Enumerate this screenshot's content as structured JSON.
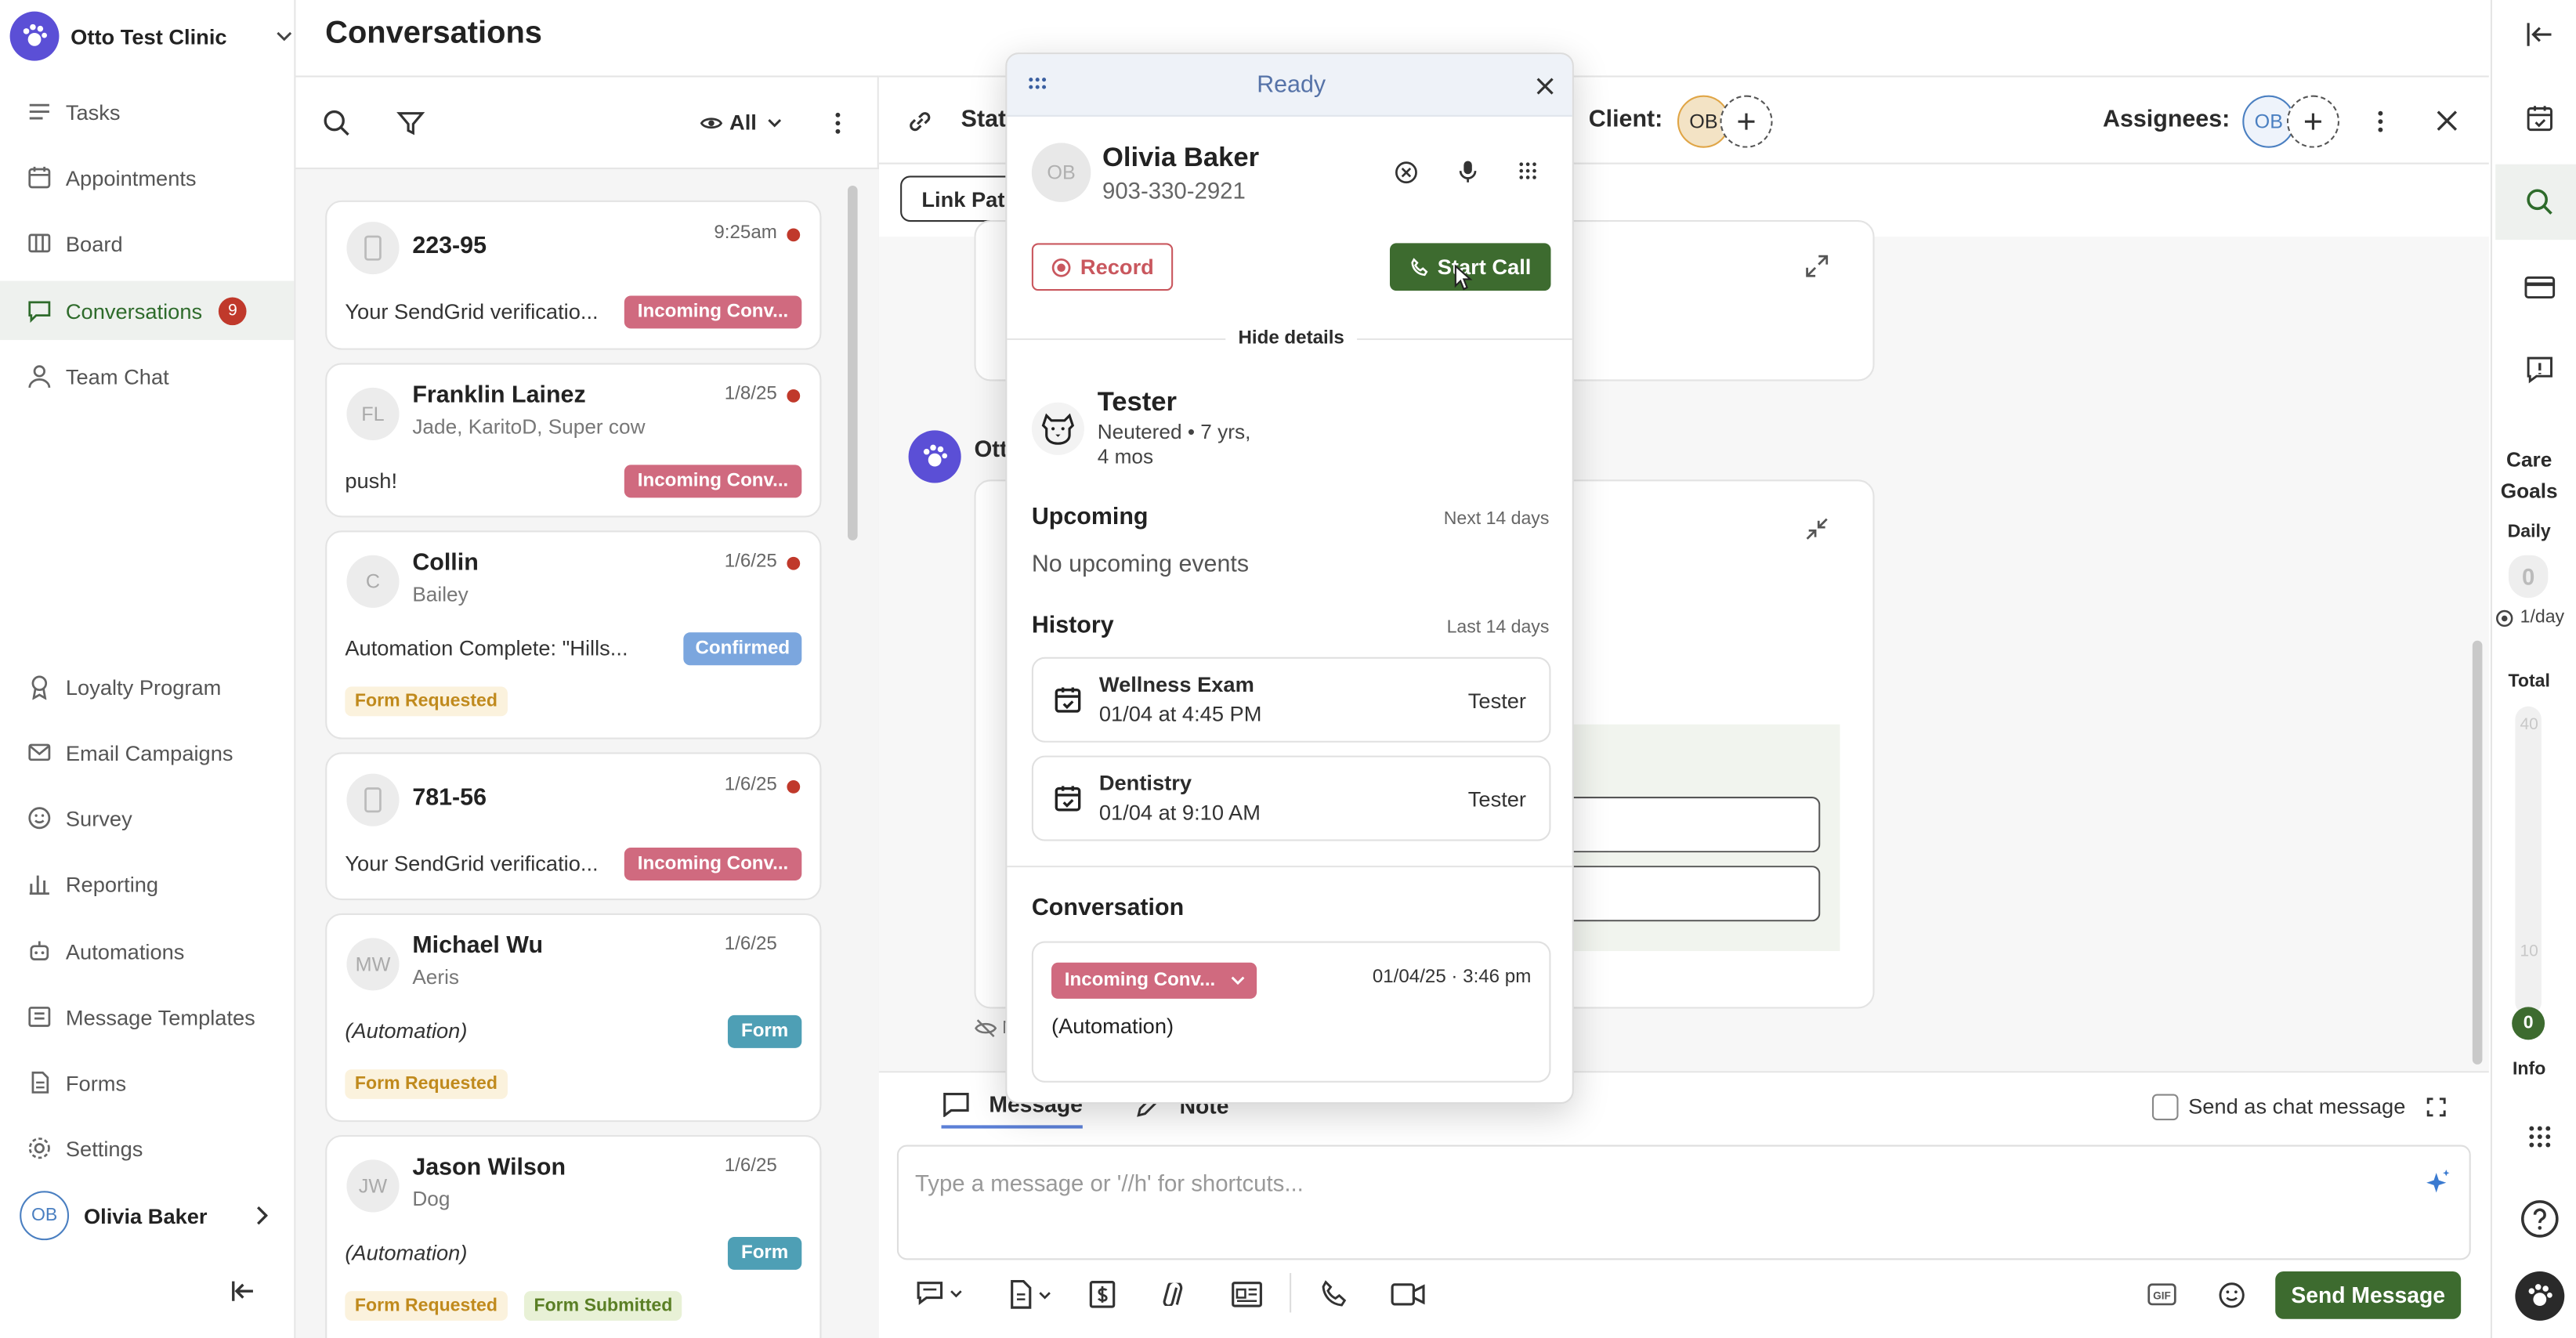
{
  "app": {
    "clinic_name": "Otto Test Clinic",
    "page_title": "Conversations"
  },
  "sidebar": {
    "items": [
      {
        "label": "Tasks",
        "icon": "tasks-icon"
      },
      {
        "label": "Appointments",
        "icon": "calendar-icon"
      },
      {
        "label": "Board",
        "icon": "board-icon"
      },
      {
        "label": "Conversations",
        "icon": "chat-icon",
        "badge": "9",
        "active": true
      },
      {
        "label": "Team Chat",
        "icon": "team-icon"
      },
      {
        "label": "Loyalty Program",
        "icon": "loyalty-icon"
      },
      {
        "label": "Email Campaigns",
        "icon": "mail-icon"
      },
      {
        "label": "Survey",
        "icon": "smile-icon"
      },
      {
        "label": "Reporting",
        "icon": "chart-icon"
      },
      {
        "label": "Automations",
        "icon": "robot-icon"
      },
      {
        "label": "Message Templates",
        "icon": "template-icon"
      },
      {
        "label": "Forms",
        "icon": "form-icon"
      },
      {
        "label": "Settings",
        "icon": "gear-icon"
      }
    ],
    "user": {
      "initials": "OB",
      "name": "Olivia Baker"
    }
  },
  "list": {
    "filter_label": "All",
    "conversations": [
      {
        "avatar": "",
        "name": "223-95",
        "sub": "",
        "date": "9:25am",
        "message": "Your SendGrid verificatio...",
        "status": "Incoming Conv...",
        "status_color": "pink",
        "unread": true
      },
      {
        "avatar": "FL",
        "name": "Franklin Lainez",
        "sub": "Jade, KaritoD, Super cow",
        "date": "1/8/25",
        "message": "push!",
        "status": "Incoming Conv...",
        "status_color": "pink",
        "unread": true
      },
      {
        "avatar": "C",
        "name": "Collin",
        "sub": "Bailey",
        "date": "1/6/25",
        "message": "Automation Complete: \"Hills...",
        "status": "Confirmed",
        "status_color": "blue",
        "unread": true,
        "tags": [
          "Form Requested"
        ]
      },
      {
        "avatar": "",
        "name": "781-56",
        "sub": "",
        "date": "1/6/25",
        "message": "Your SendGrid verificatio...",
        "status": "Incoming Conv...",
        "status_color": "pink",
        "unread": true
      },
      {
        "avatar": "MW",
        "name": "Michael Wu",
        "sub": "Aeris",
        "date": "1/6/25",
        "message": "(Automation)",
        "status": "Form",
        "status_color": "teal",
        "unread": false,
        "tags": [
          "Form Requested"
        ]
      },
      {
        "avatar": "JW",
        "name": "Jason Wilson",
        "sub": "Dog",
        "date": "1/6/25",
        "message": "(Automation)",
        "status": "Form",
        "status_color": "teal",
        "unread": false,
        "tags": [
          "Form Requested",
          "Form Submitted"
        ]
      }
    ]
  },
  "chat": {
    "status_label": "Stat",
    "client_label": "Client:",
    "client_initials": "OB",
    "assignees_label": "Assignees:",
    "assignee_initials": "OB",
    "link_patient_label": "Link Pati",
    "sender_partial": "Ott",
    "hidden_note_partial": "N"
  },
  "composer": {
    "tab_message": "Message",
    "tab_note": "Note",
    "send_as_chat": "Send as chat message",
    "placeholder": "Type a message or '//h' for shortcuts...",
    "send_button": "Send Message"
  },
  "rail": {
    "care_goals_title": "Care Goals",
    "daily_label": "Daily",
    "daily_value": "0",
    "per_day": "1/day",
    "total_label": "Total",
    "scale_top": "40",
    "scale_mid": "10",
    "total_value": "0",
    "info_label": "Info"
  },
  "popup": {
    "status": "Ready",
    "caller_initials": "OB",
    "caller_name": "Olivia Baker",
    "caller_phone": "903-330-2921",
    "record_label": "Record",
    "start_call_label": "Start Call",
    "hide_details_label": "Hide details",
    "pet": {
      "name": "Tester",
      "details": "Neutered • 7 yrs,",
      "details2": "4 mos"
    },
    "upcoming": {
      "title": "Upcoming",
      "range": "Next 14 days",
      "empty": "No upcoming events"
    },
    "history": {
      "title": "History",
      "range": "Last 14 days",
      "events": [
        {
          "name": "Wellness Exam",
          "when": "01/04 at 4:45 PM",
          "pet": "Tester"
        },
        {
          "name": "Dentistry",
          "when": "01/04 at 9:10 AM",
          "pet": "Tester"
        }
      ]
    },
    "conversation": {
      "title": "Conversation",
      "status": "Incoming Conv...",
      "timestamp": "01/04/25 · 3:46 pm",
      "message": "(Automation)"
    }
  },
  "colors": {
    "accent_green": "#3d6b2f",
    "brand_purple": "#5b4fd6",
    "status_pink": "#d06a7f",
    "status_blue": "#7ba6de",
    "status_teal": "#4e9fb5",
    "unread_red": "#c0392b"
  }
}
